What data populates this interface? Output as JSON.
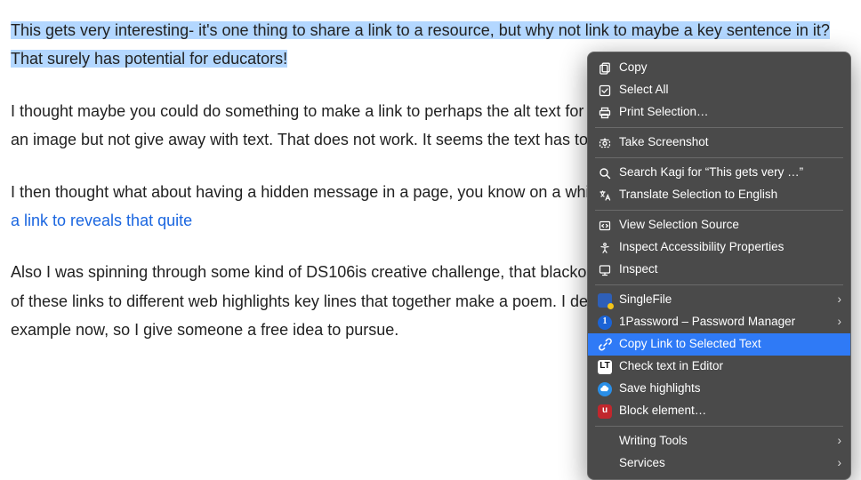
{
  "article": {
    "p1_selected": "This gets very interesting- it's one thing to share a link to a resource, but why not link to maybe a key sentence in it? That surely has potential for educators!",
    "p2": "I thought maybe you could do something to make a link to perhaps the alt text for an image, e.g. you could deep link to an image but not give away with text. That does not work. It seems the text has to be something on ",
    "p3a": "I then thought what about having a hidden message in a page, you know on a white background. You could then ",
    "p3_link": "make a link to reveals that quite",
    "p4": "Also I was spinning through some kind of DS106is creative challenge, that blackout poetry but you could have a series of these links to different web highlights key lines that together make a poem. I decided to now go through make that example now, so I give someone a free idea to pursue."
  },
  "menu": {
    "copy": "Copy",
    "select_all": "Select All",
    "print_selection": "Print Selection…",
    "take_screenshot": "Take Screenshot",
    "search_kagi": "Search Kagi for “This gets very …”",
    "translate": "Translate Selection to English",
    "view_source": "View Selection Source",
    "inspect_a11y": "Inspect Accessibility Properties",
    "inspect": "Inspect",
    "ext_singlefile": "SingleFile",
    "ext_1password": "1Password – Password Manager",
    "ext_copy_link_selected": "Copy Link to Selected Text",
    "ext_check_editor": "Check text in Editor",
    "ext_save_highlights": "Save highlights",
    "ext_block_element": "Block element…",
    "writing_tools": "Writing Tools",
    "services": "Services",
    "submenu_glyph": "›"
  }
}
